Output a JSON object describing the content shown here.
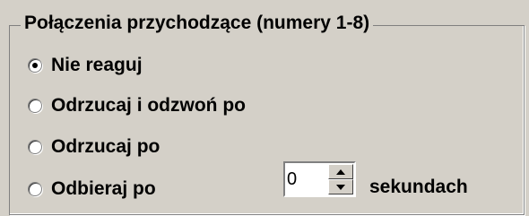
{
  "group": {
    "title": "Połączenia przychodzące (numery 1-8)"
  },
  "options": [
    {
      "label": "Nie reaguj",
      "checked": true
    },
    {
      "label": "Odrzucaj i odzwoń po",
      "checked": false
    },
    {
      "label": "Odrzucaj po",
      "checked": false
    },
    {
      "label": "Odbieraj po",
      "checked": false
    }
  ],
  "spinner": {
    "value": "0"
  },
  "units_label": "sekundach"
}
